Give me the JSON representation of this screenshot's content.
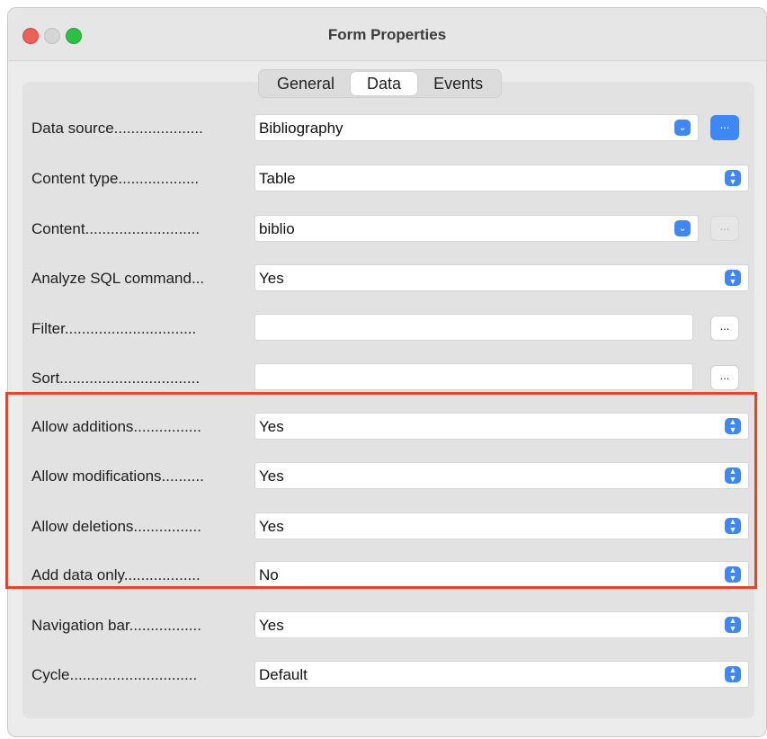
{
  "window": {
    "title": "Form Properties"
  },
  "tabs": [
    {
      "label": "General"
    },
    {
      "label": "Data"
    },
    {
      "label": "Events"
    }
  ],
  "rows": [
    {
      "label": "Data source.....................",
      "value": "Bibliography"
    },
    {
      "label": "Content type...................",
      "value": "Table"
    },
    {
      "label": "Content...........................",
      "value": "biblio"
    },
    {
      "label": "Analyze SQL command...",
      "value": "Yes"
    },
    {
      "label": "Filter...............................",
      "value": ""
    },
    {
      "label": "Sort.................................",
      "value": ""
    },
    {
      "label": "Allow additions................",
      "value": "Yes"
    },
    {
      "label": "Allow modifications..........",
      "value": "Yes"
    },
    {
      "label": "Allow deletions................",
      "value": "Yes"
    },
    {
      "label": "Add data only..................",
      "value": "No"
    },
    {
      "label": "Navigation bar.................",
      "value": "Yes"
    },
    {
      "label": "Cycle..............................",
      "value": "Default"
    }
  ],
  "button_label": "...",
  "colors": {
    "accent": "#3f87f5",
    "highlight": "#e0452d"
  }
}
